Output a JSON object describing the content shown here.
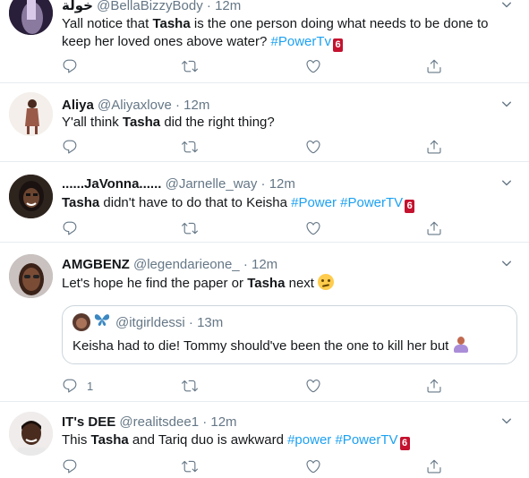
{
  "colors": {
    "accent": "#1da1f2",
    "muted": "#657786",
    "divider": "#e6ecf0",
    "tv_badge": "#c4122f"
  },
  "icons": {
    "reply": "reply-icon",
    "retweet": "retweet-icon",
    "like": "heart-icon",
    "share": "share-icon",
    "more": "chevron-down-icon"
  },
  "tweets": [
    {
      "name": "خولة",
      "handle": "@BellaBizzyBody",
      "time": "12m",
      "text": {
        "a": "Yall notice that ",
        "b": "Tasha",
        "c": " is the one person doing what needs to be done to",
        "line2": "keep her loved ones above water? ",
        "tag1": "#PowerTv",
        "badge": "6"
      },
      "reply_count": ""
    },
    {
      "name": "Aliya",
      "handle": "@Aliyaxlove",
      "time": "12m",
      "text": {
        "a": "Y'all think ",
        "b": "Tasha",
        "c": " did the right thing?"
      },
      "reply_count": ""
    },
    {
      "name": "......JaVonna......",
      "handle": "@Jarnelle_way",
      "time": "12m",
      "text": {
        "b": "Tasha",
        "c": " didn't have to do that to Keisha ",
        "tag1": "#Power",
        "tag2": "#PowerTV",
        "badge": "6"
      },
      "reply_count": ""
    },
    {
      "name": "AMGBENZ",
      "handle": "@legendarieone_",
      "time": "12m",
      "text": {
        "a": "Let's hope he find the paper or ",
        "b": "Tasha",
        "c": " next "
      },
      "quote": {
        "handle": "@itgirldessi",
        "time": "13m",
        "text": "Keisha had to die! Tommy should've been the one to kill her but "
      },
      "reply_count": "1"
    },
    {
      "name": "IT's DEE",
      "handle": "@realitsdee1",
      "time": "12m",
      "text": {
        "a": "This ",
        "b": "Tasha",
        "c": " and Tariq duo is awkward ",
        "tag1": "#power",
        "tag2": "#PowerTV",
        "badge": "6"
      },
      "reply_count": ""
    }
  ],
  "sep": "·"
}
